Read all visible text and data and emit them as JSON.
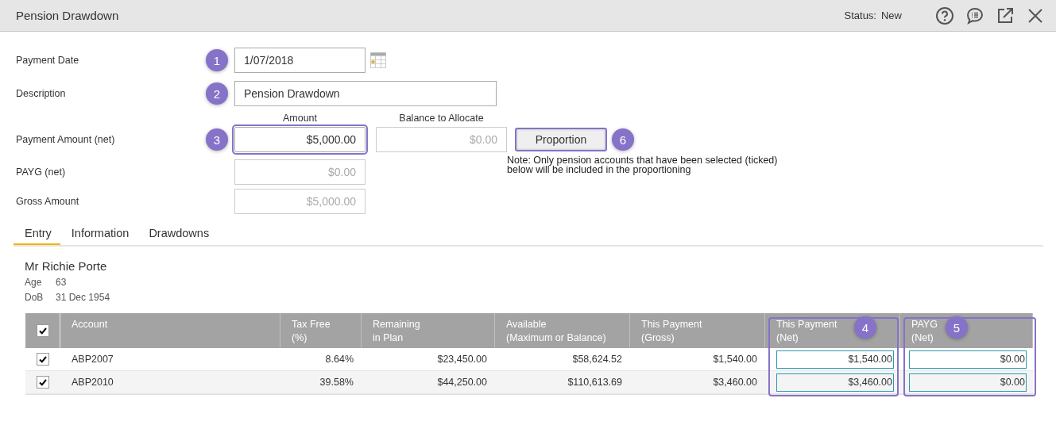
{
  "window": {
    "title": "Pension Drawdown",
    "status_label": "Status:",
    "status": "New"
  },
  "form": {
    "payment_date": {
      "label": "Payment Date",
      "value": "1/07/2018",
      "callout": "1"
    },
    "description": {
      "label": "Description",
      "value": "Pension Drawdown",
      "callout": "2"
    },
    "amount_heading": "Amount",
    "balance_heading": "Balance to Allocate",
    "payment_amount": {
      "label": "Payment Amount (net)",
      "value": "$5,000.00",
      "callout": "3",
      "balance": "$0.00"
    },
    "payg": {
      "label": "PAYG (net)",
      "value": "$0.00"
    },
    "gross": {
      "label": "Gross Amount",
      "value": "$5,000.00"
    },
    "proportion_button": {
      "label": "Proportion",
      "callout": "6"
    },
    "note": "Note: Only pension accounts that have been selected (ticked)\nbelow will be included in the proportioning"
  },
  "tabs": [
    {
      "label": "Entry",
      "selected": true
    },
    {
      "label": "Information",
      "selected": false
    },
    {
      "label": "Drawdowns",
      "selected": false
    }
  ],
  "member": {
    "name": "Mr Richie Porte",
    "age_label": "Age",
    "age": "63",
    "dob_label": "DoB",
    "dob": "31 Dec 1954"
  },
  "table": {
    "all_checked": true,
    "columns": [
      {
        "label": "Account"
      },
      {
        "label": "Tax Free\n(%)"
      },
      {
        "label": "Remaining\nin Plan"
      },
      {
        "label": "Available\n(Maximum or Balance)"
      },
      {
        "label": "This Payment\n(Gross)"
      },
      {
        "label": "This Payment\n(Net)",
        "callout": "4"
      },
      {
        "label": "PAYG\n(Net)",
        "callout": "5"
      }
    ],
    "rows": [
      {
        "checked": true,
        "account": "ABP2007",
        "tax_free": "8.64%",
        "remaining": "$23,450.00",
        "available": "$58,624.52",
        "gross": "$1,540.00",
        "net": "$1,540.00",
        "payg": "$0.00"
      },
      {
        "checked": true,
        "account": "ABP2010",
        "tax_free": "39.58%",
        "remaining": "$44,250.00",
        "available": "$110,613.69",
        "gross": "$3,460.00",
        "net": "$3,460.00",
        "payg": "$0.00"
      }
    ]
  }
}
